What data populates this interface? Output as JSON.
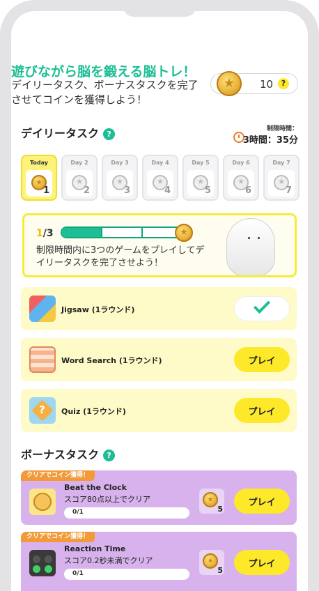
{
  "header": {
    "headline": "遊びながら脳を鍛える脳トレ！",
    "subline": "デイリータスク、ボーナスタスクを完了させてコインを獲得しよう！",
    "coins": "10",
    "help": "?"
  },
  "daily": {
    "title": "デイリータスク",
    "help": "?",
    "limit_label": "制限時間：",
    "limit_time": "3時間：35分",
    "days": [
      {
        "label": "Today",
        "num": "1"
      },
      {
        "label": "Day 2",
        "num": "2"
      },
      {
        "label": "Day 3",
        "num": "3"
      },
      {
        "label": "Day 4",
        "num": "4"
      },
      {
        "label": "Day 5",
        "num": "5"
      },
      {
        "label": "Day 6",
        "num": "6"
      },
      {
        "label": "Day 7",
        "num": "7"
      }
    ],
    "progress": {
      "done": "1",
      "total": "/3",
      "fraction": 0.333,
      "desc": "制限時間内に3つのゲームをプレイしてデイリータスクを完了させよう！"
    },
    "tasks": [
      {
        "name": "Jigsaw (1ラウンド)",
        "status": "done"
      },
      {
        "name": "Word Search  (1ラウンド)",
        "button": "プレイ"
      },
      {
        "name": "Quiz (1ラウンド)",
        "button": "プレイ"
      }
    ]
  },
  "bonus": {
    "title": "ボーナスタスク",
    "help": "?",
    "items": [
      {
        "tag": "クリアでコイン獲得！",
        "title": "Beat the Clock",
        "desc": "スコア80点以上でクリア",
        "progress": "0/1",
        "reward": "5",
        "button": "プレイ"
      },
      {
        "tag": "クリアでコイン獲得！",
        "title": "Reaction Time",
        "desc": "スコア0.2秒未満でクリア",
        "progress": "0/1",
        "reward": "5",
        "button": "プレイ"
      }
    ]
  },
  "colors": {
    "accent": "#1dbe95",
    "yellow": "#fde82a",
    "bonus": "#d7b2ec",
    "tag": "#f29a3a"
  }
}
